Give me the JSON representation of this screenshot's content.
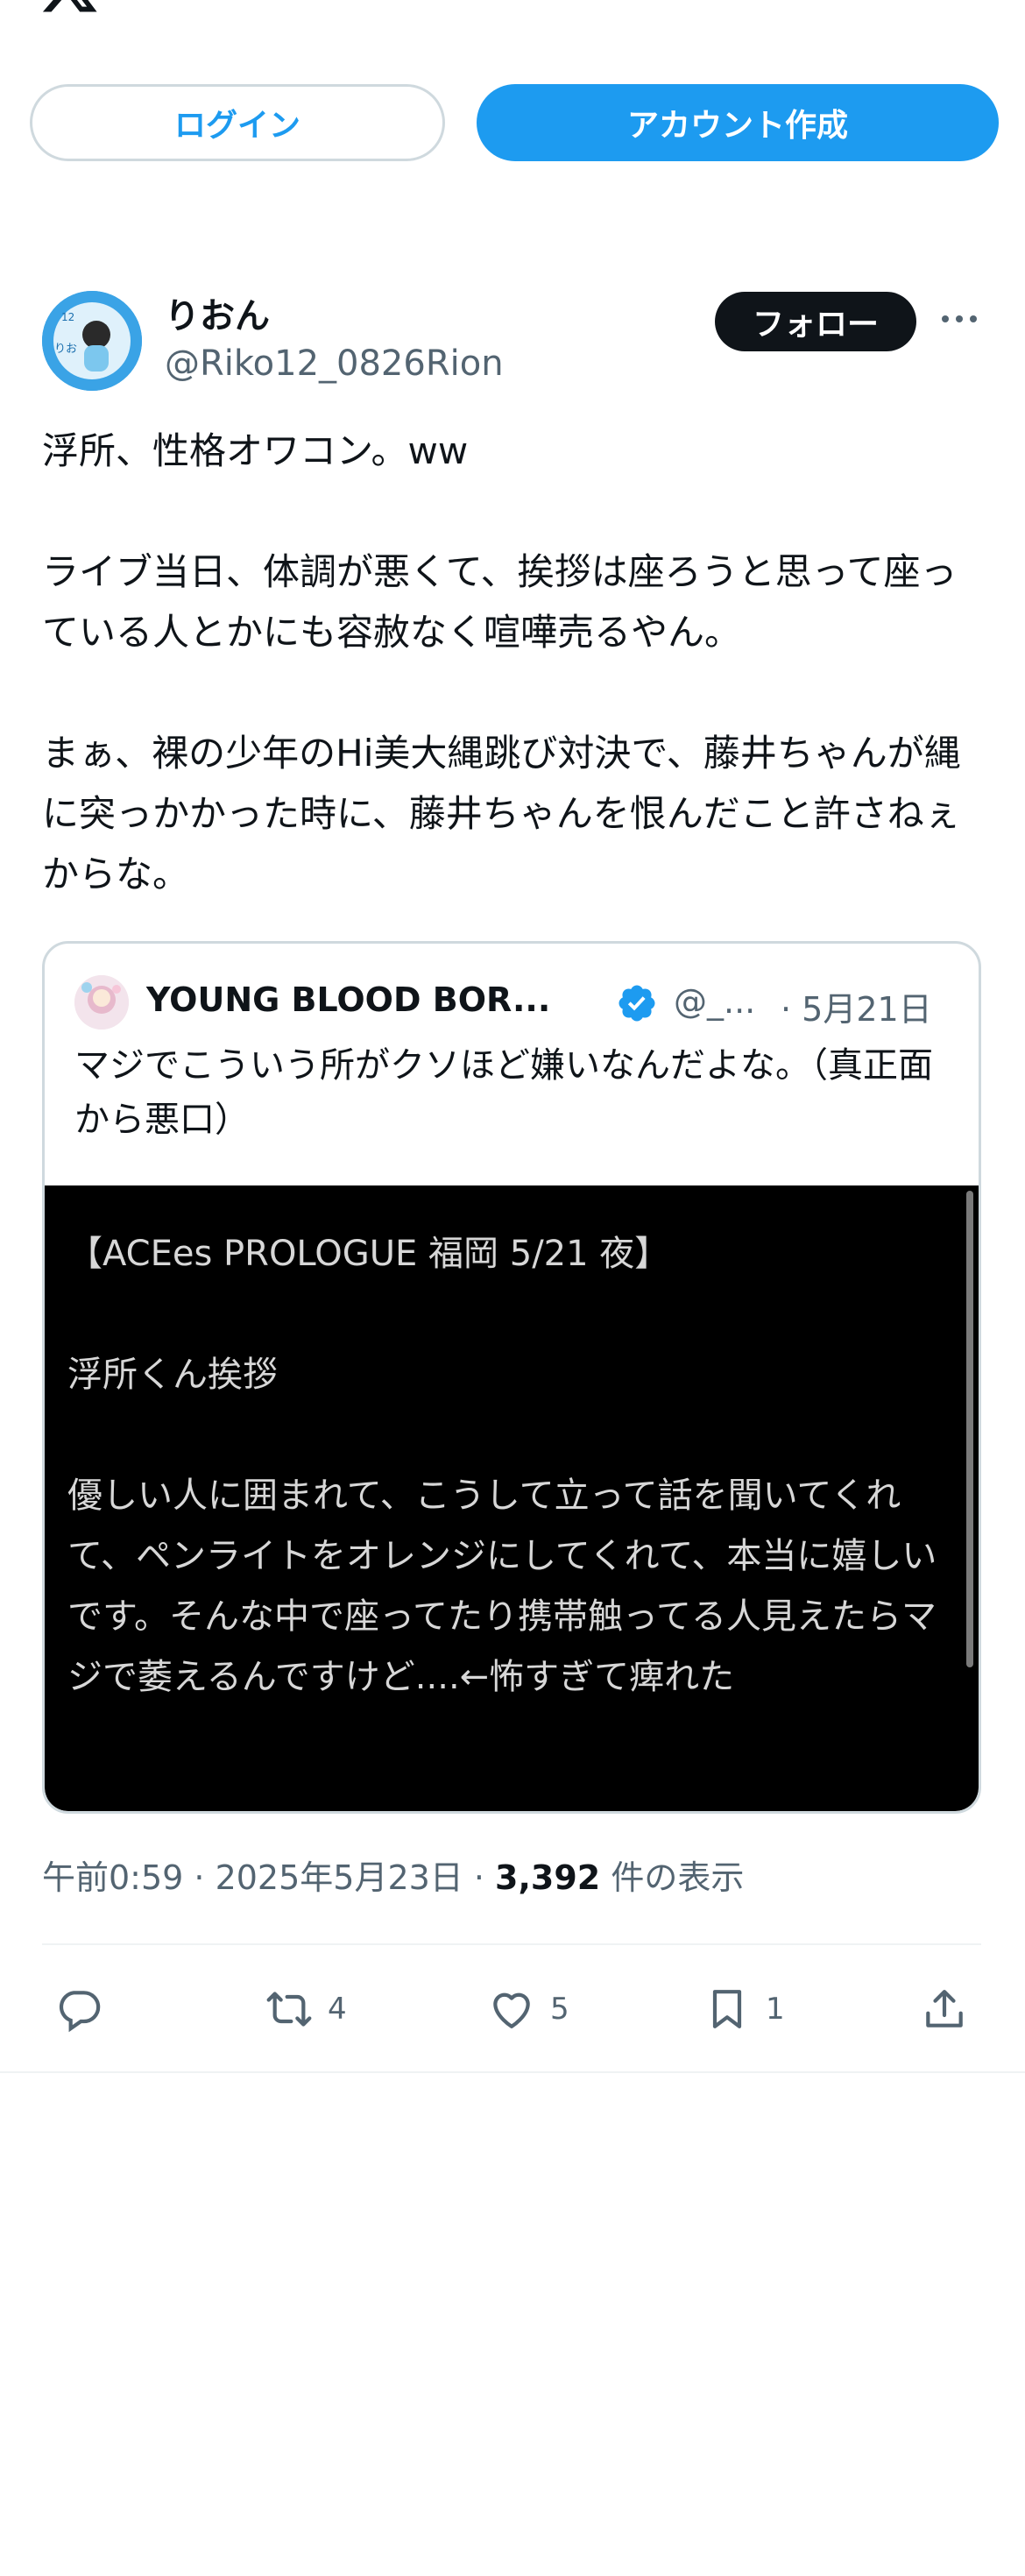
{
  "header": {
    "logo": "x-logo-icon"
  },
  "auth": {
    "login_label": "ログイン",
    "signup_label": "アカウント作成"
  },
  "tweet": {
    "display_name": "りおん",
    "handle": "@Riko12_0826Rion",
    "follow_label": "フォロー",
    "text": "浮所、性格オワコン。ww\n\nライブ当日、体調が悪くて、挨拶は座ろうと思って座っている人とかにも容赦なく喧嘩売るやん。\n\nまぁ、裸の少年のHi美大縄跳び対決で、藤井ちゃんが縄に突っかかった時に、藤井ちゃんを恨んだこと許さねぇからな。",
    "timestamp": "午前0:59 · 2025年5月23日 · ",
    "views_count": "3,392",
    "views_label": " 件の表示"
  },
  "quote": {
    "name": "YOUNG BLOOD BOR...",
    "handle": "@_...",
    "date": "· 5月21日",
    "text": "マジでこういう所がクソほど嫌いなんだよな。（真正面から悪口）",
    "image_text": "【ACEes PROLOGUE 福岡 5/21 夜】\n\n浮所くん挨拶\n\n優しい人に囲まれて、こうして立って話を聞いてくれて、ペンライトをオレンジにしてくれて、本当に嬉しいです。そんな中で座ってたり携帯触ってる人見えたらマジで萎えるんですけど....←怖すぎて痺れた"
  },
  "actions": {
    "reply_count": "",
    "retweet_count": "4",
    "like_count": "5",
    "bookmark_count": "1"
  },
  "colors": {
    "accent": "#1d9bf0",
    "text": "#0f1419",
    "muted": "#536471",
    "border": "#cfd9de"
  }
}
